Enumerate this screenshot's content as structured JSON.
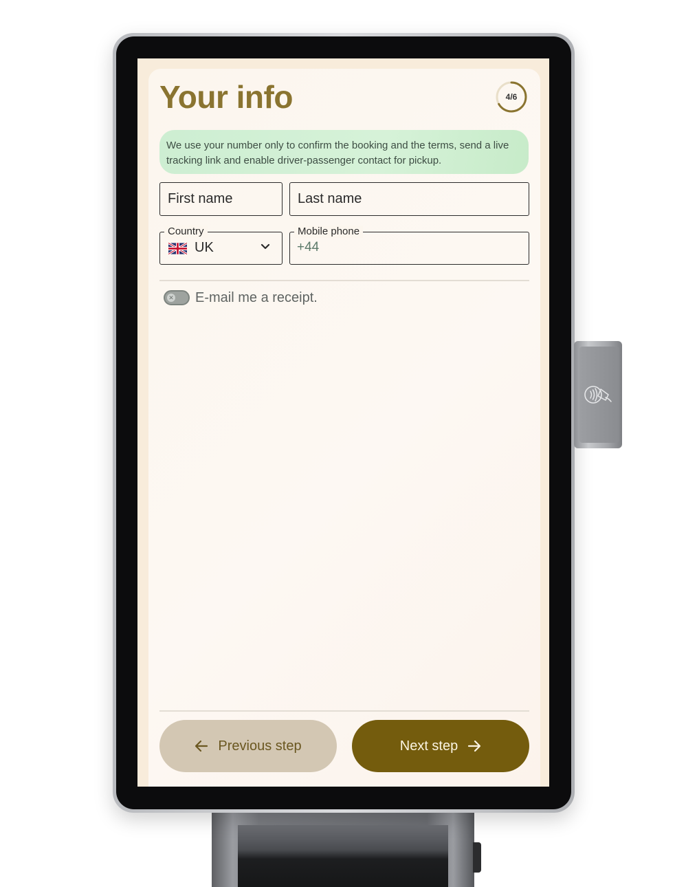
{
  "page": {
    "title": "Your info",
    "step_indicator": "4/6",
    "step_progress": 0.6667,
    "notice": "We use your number only to confirm the booking and the terms, send a live tracking link and enable driver-passenger contact for pickup."
  },
  "form": {
    "first_name_placeholder": "First name",
    "last_name_placeholder": "Last name",
    "country_label": "Country",
    "country_value": "UK",
    "country_flag": "uk-flag-icon",
    "phone_label": "Mobile phone",
    "phone_prefix": "+44",
    "email_receipt_label": "E-mail me a receipt.",
    "email_receipt_enabled": false
  },
  "nav": {
    "prev_label": "Previous step",
    "next_label": "Next step"
  },
  "colors": {
    "accent": "#745c0d",
    "title": "#8a7430",
    "notice_bg": "#d6f2d8"
  }
}
